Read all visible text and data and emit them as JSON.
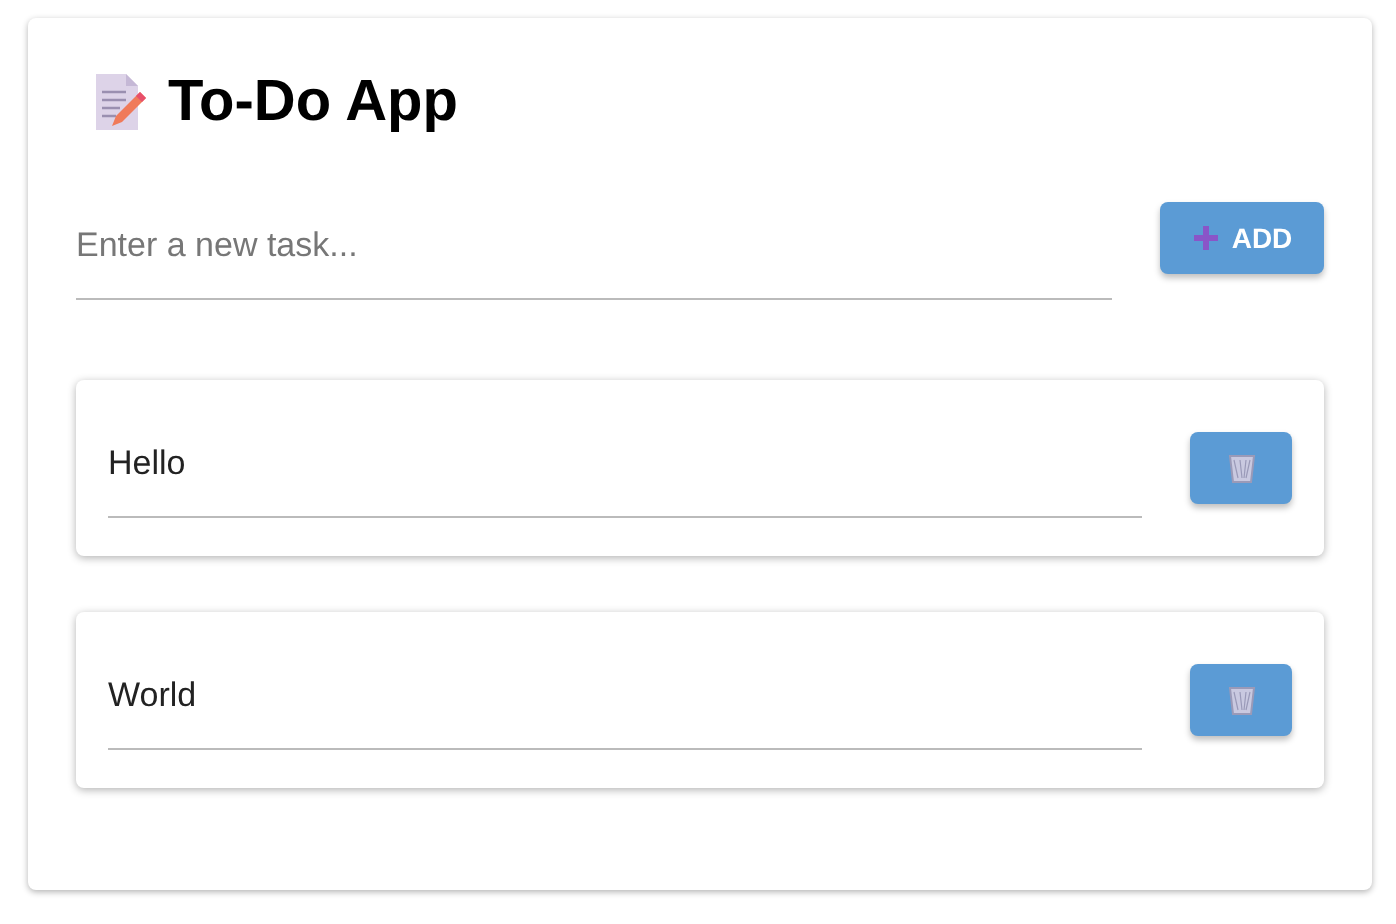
{
  "title": "To-Do App",
  "new_task": {
    "placeholder": "Enter a new task..."
  },
  "add_button": {
    "label": "ADD"
  },
  "tasks": [
    {
      "text": "Hello"
    },
    {
      "text": "World"
    }
  ]
}
